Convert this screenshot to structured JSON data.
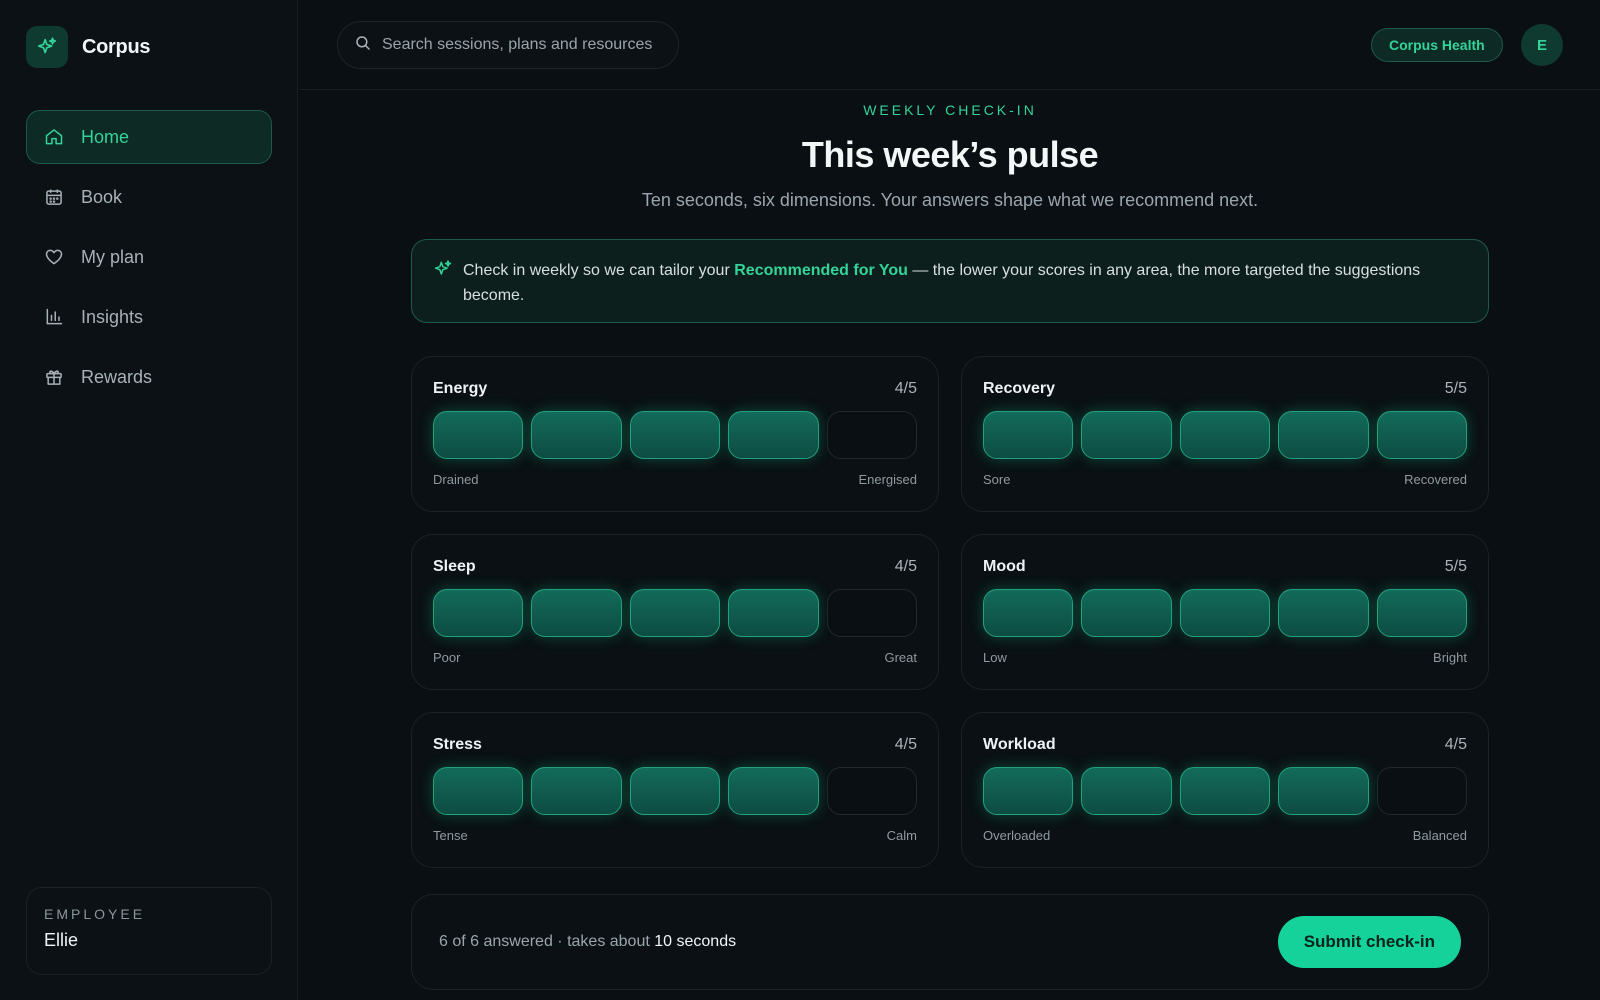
{
  "brand": {
    "name": "Corpus",
    "logo_icon": "sparkle-icon"
  },
  "sidebar": {
    "items": [
      {
        "label": "Home",
        "icon": "home-icon",
        "active": true
      },
      {
        "label": "Book",
        "icon": "calendar-icon",
        "active": false
      },
      {
        "label": "My plan",
        "icon": "heart-icon",
        "active": false
      },
      {
        "label": "Insights",
        "icon": "bar-chart-icon",
        "active": false
      },
      {
        "label": "Rewards",
        "icon": "gift-icon",
        "active": false
      }
    ],
    "employee": {
      "label": "EMPLOYEE",
      "name": "Ellie"
    }
  },
  "topbar": {
    "search_placeholder": "Search sessions, plans and resources",
    "org_pill": "Corpus Health",
    "avatar_initial": "E"
  },
  "main": {
    "eyebrow": "WEEKLY CHECK-IN",
    "title": "This week’s pulse",
    "subtitle": "Ten seconds, six dimensions. Your answers shape what we recommend next.",
    "info": {
      "before": "Check in weekly so we can tailor your ",
      "highlight": "Recommended for You",
      "after": " — the lower your scores in any area, the more targeted the suggestions become."
    },
    "dimensions": [
      {
        "label": "Energy",
        "score": 4,
        "score_text": "4/5",
        "low": "Drained",
        "high": "Energised"
      },
      {
        "label": "Recovery",
        "score": 5,
        "score_text": "5/5",
        "low": "Sore",
        "high": "Recovered"
      },
      {
        "label": "Sleep",
        "score": 4,
        "score_text": "4/5",
        "low": "Poor",
        "high": "Great"
      },
      {
        "label": "Mood",
        "score": 5,
        "score_text": "5/5",
        "low": "Low",
        "high": "Bright"
      },
      {
        "label": "Stress",
        "score": 4,
        "score_text": "4/5",
        "low": "Tense",
        "high": "Calm"
      },
      {
        "label": "Workload",
        "score": 4,
        "score_text": "4/5",
        "low": "Overloaded",
        "high": "Balanced"
      }
    ],
    "footer": {
      "answered": "6 of 6 answered · takes about ",
      "duration": "10 seconds",
      "submit_label": "Submit check-in"
    }
  },
  "colors": {
    "accent": "#34d399",
    "button": "#14d29a",
    "background": "#0a0f13"
  }
}
